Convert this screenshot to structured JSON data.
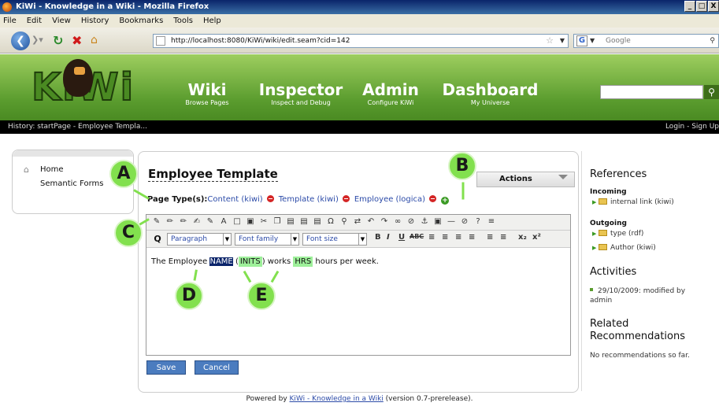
{
  "window": {
    "title": "KiWi - Knowledge in a Wiki - Mozilla Firefox",
    "buttons": [
      "_",
      "□",
      "X"
    ]
  },
  "menubar": [
    "File",
    "Edit",
    "View",
    "History",
    "Bookmarks",
    "Tools",
    "Help"
  ],
  "browser": {
    "url": "http://localhost:8080/KiWi/wiki/edit.seam?cid=142",
    "search_placeholder": "Google"
  },
  "site": {
    "logo": "KiWi",
    "nav": [
      {
        "label": "Wiki",
        "sub": "Browse Pages"
      },
      {
        "label": "Inspector",
        "sub": "Inspect and Debug"
      },
      {
        "label": "Admin",
        "sub": "Configure KiWi"
      },
      {
        "label": "Dashboard",
        "sub": "My Universe"
      }
    ]
  },
  "history": {
    "text": "History: startPage - Employee Templa...",
    "login": "Login - Sign Up"
  },
  "leftnav": {
    "items": [
      "Home",
      "Semantic Forms"
    ]
  },
  "page": {
    "title": "Employee Template",
    "actions": "Actions",
    "types_label": "Page Type(s):",
    "types": [
      "Content (kiwi)",
      "Template (kiwi)",
      "Employee (logica)"
    ]
  },
  "editor": {
    "paragraph": "Paragraph",
    "font_family": "Font family",
    "font_size": "Font size",
    "content": {
      "before": "The Employee ",
      "name": "NAME",
      "open": " (",
      "inits": "INITS",
      "mid": ") works ",
      "hrs": "HRS",
      "after": " hours per week."
    }
  },
  "callouts": [
    "A",
    "B",
    "C",
    "D",
    "E"
  ],
  "buttons": {
    "save": "Save",
    "cancel": "Cancel"
  },
  "sidebar": {
    "references": "References",
    "incoming": "Incoming",
    "incoming_items": [
      "internal link (kiwi)"
    ],
    "outgoing": "Outgoing",
    "outgoing_items": [
      "type (rdf)",
      "Author (kiwi)"
    ],
    "activities": "Activities",
    "activity_items": [
      "29/10/2009: modified by admin"
    ],
    "related": "Related Recommendations",
    "no_recommendations": "No recommendations so far."
  },
  "footer": {
    "before": "Powered by ",
    "link": "KiWi - Knowledge in a Wiki",
    "after": " (version 0.7-prerelease)."
  }
}
